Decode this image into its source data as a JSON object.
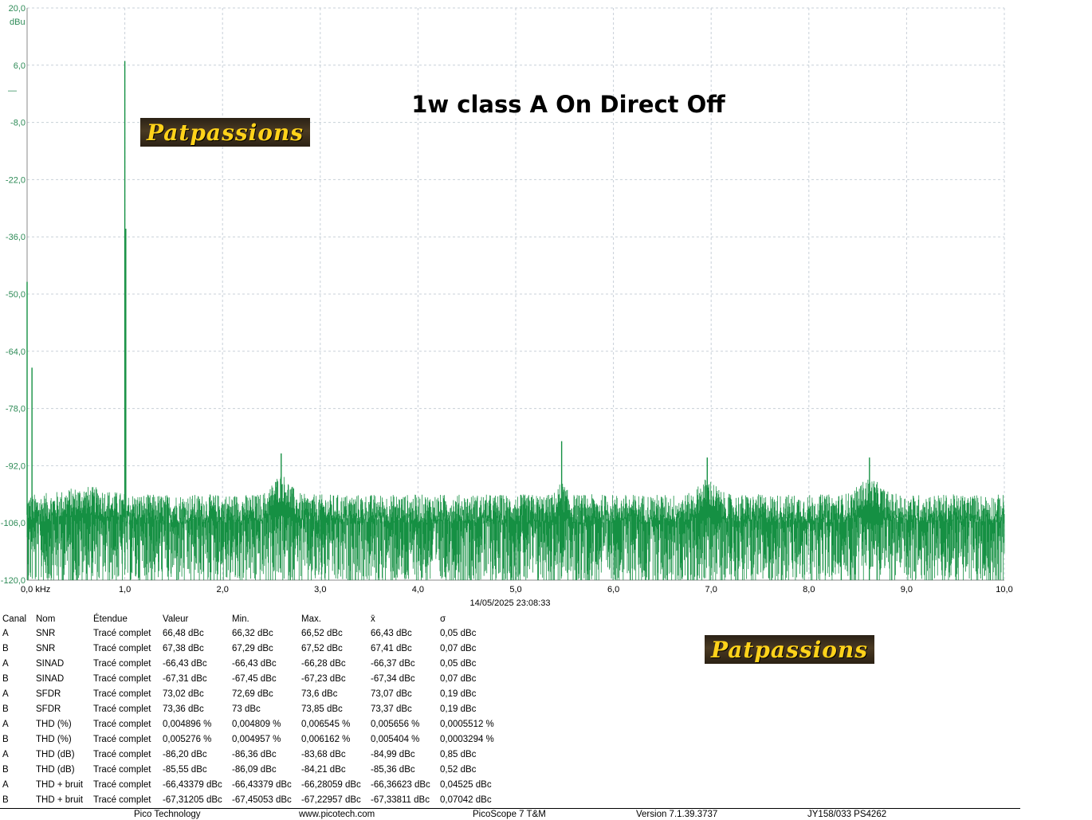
{
  "chart_data": {
    "type": "line",
    "title": "1w class A On Direct Off",
    "ylabel": "dBu",
    "xlabel": "",
    "x_unit": "kHz",
    "xlim": [
      0,
      10
    ],
    "ylim": [
      -120,
      20
    ],
    "y_ticks": [
      "20,0",
      "6,0",
      "-8,0",
      "-22,0",
      "-36,0",
      "-50,0",
      "-64,0",
      "-78,0",
      "-92,0",
      "-106,0",
      "-120,0"
    ],
    "x_ticks": [
      "0,0 kHz",
      "1,0",
      "2,0",
      "3,0",
      "4,0",
      "5,0",
      "6,0",
      "7,0",
      "8,0",
      "9,0",
      "10,0"
    ],
    "grid": true,
    "line_color": "#159043",
    "noise_floor": {
      "center": -100,
      "min": -120,
      "max": -92
    },
    "peaks": [
      {
        "x": 0.0,
        "y": -47
      },
      {
        "x": 0.05,
        "y": -68
      },
      {
        "x": 1.0,
        "y": 7
      },
      {
        "x": 1.01,
        "y": -34
      },
      {
        "x": 5.47,
        "y": -86
      },
      {
        "x": 2.6,
        "y": -89
      },
      {
        "x": 6.96,
        "y": -90
      },
      {
        "x": 8.62,
        "y": -90
      }
    ],
    "legend_marker": "—"
  },
  "timestamp": "14/05/2025 23:08:33",
  "watermark": "Patpassions",
  "measurements": {
    "headers": [
      "Canal",
      "Nom",
      "Étendue",
      "Valeur",
      "Min.",
      "Max.",
      "x̄",
      "σ"
    ],
    "rows": [
      [
        "A",
        "SNR",
        "Tracé complet",
        "66,48 dBc",
        "66,32 dBc",
        "66,52 dBc",
        "66,43 dBc",
        "0,05 dBc"
      ],
      [
        "B",
        "SNR",
        "Tracé complet",
        "67,38 dBc",
        "67,29 dBc",
        "67,52 dBc",
        "67,41 dBc",
        "0,07 dBc"
      ],
      [
        "A",
        "SINAD",
        "Tracé complet",
        "-66,43 dBc",
        "-66,43 dBc",
        "-66,28 dBc",
        "-66,37 dBc",
        "0,05 dBc"
      ],
      [
        "B",
        "SINAD",
        "Tracé complet",
        "-67,31 dBc",
        "-67,45 dBc",
        "-67,23 dBc",
        "-67,34 dBc",
        "0,07 dBc"
      ],
      [
        "A",
        "SFDR",
        "Tracé complet",
        "73,02 dBc",
        "72,69 dBc",
        "73,6 dBc",
        "73,07 dBc",
        "0,19 dBc"
      ],
      [
        "B",
        "SFDR",
        "Tracé complet",
        "73,36 dBc",
        "73 dBc",
        "73,85 dBc",
        "73,37 dBc",
        "0,19 dBc"
      ],
      [
        "A",
        "THD (%)",
        "Tracé complet",
        "0,004896 %",
        "0,004809 %",
        "0,006545 %",
        "0,005656 %",
        "0,0005512 %"
      ],
      [
        "B",
        "THD (%)",
        "Tracé complet",
        "0,005276 %",
        "0,004957 %",
        "0,006162 %",
        "0,005404 %",
        "0,0003294 %"
      ],
      [
        "A",
        "THD (dB)",
        "Tracé complet",
        "-86,20 dBc",
        "-86,36 dBc",
        "-83,68 dBc",
        "-84,99 dBc",
        "0,85 dBc"
      ],
      [
        "B",
        "THD (dB)",
        "Tracé complet",
        "-85,55 dBc",
        "-86,09 dBc",
        "-84,21 dBc",
        "-85,36 dBc",
        "0,52 dBc"
      ],
      [
        "A",
        "THD + bruit",
        "Tracé complet",
        "-66,43379 dBc",
        "-66,43379 dBc",
        "-66,28059 dBc",
        "-66,36623 dBc",
        "0,04525 dBc"
      ],
      [
        "B",
        "THD + bruit",
        "Tracé complet",
        "-67,31205 dBc",
        "-67,45053 dBc",
        "-67,22957 dBc",
        "-67,33811 dBc",
        "0,07042 dBc"
      ]
    ]
  },
  "footer": {
    "company": "Pico Technology",
    "url": "www.picotech.com",
    "product": "PicoScope 7 T&M",
    "version": "Version 7.1.39.3737",
    "device": "JY158/033 PS4262"
  }
}
